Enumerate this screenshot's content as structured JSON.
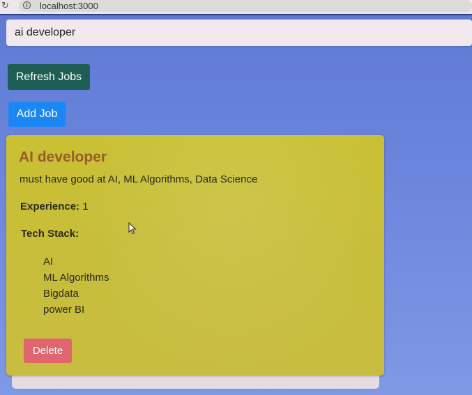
{
  "browser": {
    "reload_icon": "reload-icon",
    "info_icon": "info-icon",
    "url": "localhost:3000"
  },
  "search": {
    "value": "ai developer"
  },
  "buttons": {
    "refresh_label": "Refresh Jobs",
    "add_label": "Add Job"
  },
  "job": {
    "title": "AI developer",
    "description": "must have good at AI, ML Algorithms, Data Science",
    "experience_label": "Experience:",
    "experience_value": "1",
    "tech_stack_label": "Tech Stack:",
    "tech_stack": [
      "AI",
      "ML Algorithms",
      "Bigdata",
      "power BI"
    ],
    "delete_label": "Delete"
  },
  "colors": {
    "refresh_button": "#1f5e55",
    "add_button": "#1a87f5",
    "card_background": "#c8be3a",
    "title_color": "#9b5a2b",
    "delete_button": "#e0656c"
  }
}
